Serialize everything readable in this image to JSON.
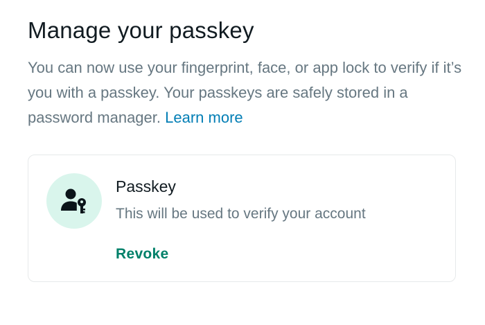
{
  "header": {
    "title": "Manage your passkey"
  },
  "description": {
    "text": "You can now use your fingerprint, face, or app lock to verify if it’s you with a passkey. Your passkeys are safely stored in a password manager.",
    "learn_more_label": "Learn more"
  },
  "passkey_card": {
    "icon": "person-key-icon",
    "title": "Passkey",
    "subtitle": "This will be used to verify your account",
    "revoke_label": "Revoke"
  },
  "colors": {
    "link": "#027eb5",
    "accent": "#008069",
    "icon_background": "#d9f5ec",
    "title_text": "#111b21",
    "secondary_text": "#667781"
  }
}
